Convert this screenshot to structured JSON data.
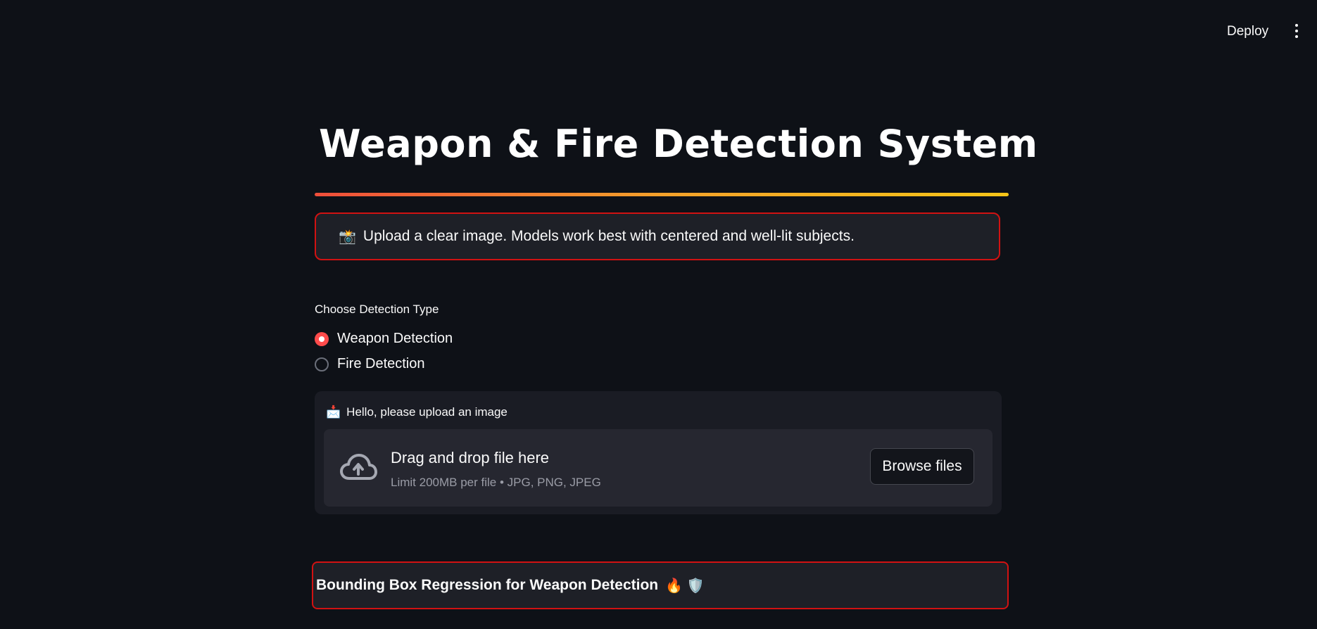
{
  "header": {
    "deploy_label": "Deploy",
    "menu_icon": "more-vertical-icon"
  },
  "main": {
    "title": "Weapon & Fire Detection System",
    "title_bar_colors": [
      "#ef4e3a",
      "#f3a12a",
      "#f5c518"
    ],
    "tip": {
      "emoji": "📸",
      "text": "Upload a clear image. Models work best with centered and well-lit subjects."
    },
    "detection": {
      "label": "Choose Detection Type",
      "options": [
        {
          "label": "Weapon Detection",
          "selected": true
        },
        {
          "label": "Fire Detection",
          "selected": false
        }
      ]
    },
    "uploader": {
      "label_emoji": "📩",
      "label": "Hello, please upload an image",
      "dropzone_title": "Drag and drop file here",
      "dropzone_limit": "Limit 200MB per file • JPG, PNG, JPEG",
      "browse_label": "Browse files",
      "icon": "cloud-upload-icon"
    },
    "bbox": {
      "text": "Bounding Box Regression for Weapon Detection",
      "emojis": "🔥 🛡️"
    }
  },
  "colors": {
    "background": "#0e1117",
    "accent": "#ff4b4b",
    "alert_border": "#d11212"
  }
}
